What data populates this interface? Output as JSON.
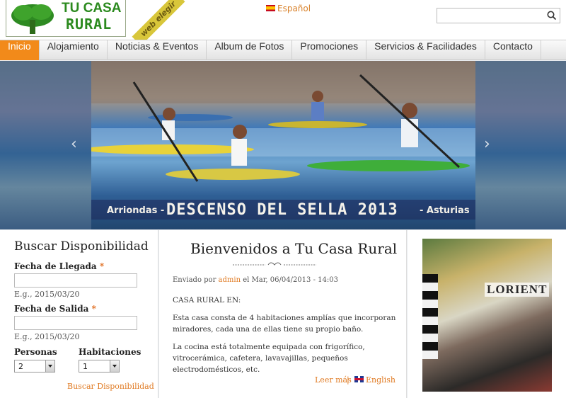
{
  "header": {
    "logo_line1": "TU CASA",
    "logo_line2": "RURAL",
    "ribbon": "web elegir",
    "language": "Español",
    "search_placeholder": "",
    "search_icon": "magnifier-icon"
  },
  "nav": {
    "items": [
      {
        "label": "Inicio"
      },
      {
        "label": "Alojamiento"
      },
      {
        "label": "Noticias & Eventos"
      },
      {
        "label": "Album de Fotos"
      },
      {
        "label": "Promociones"
      },
      {
        "label": "Servicios & Facilidades"
      },
      {
        "label": "Contacto"
      }
    ],
    "active_color": "#f28a1a"
  },
  "banner": {
    "caption_left": "Arriondas -",
    "caption_main": "DESCENSO DEL SELLA 2013",
    "caption_right": "- Asturias",
    "prev": "‹",
    "next": "›"
  },
  "search_box": {
    "title": "Buscar Disponibilidad",
    "arrival_label": "Fecha de Llegada",
    "arrival_hint": "E.g., 2015/03/20",
    "departure_label": "Fecha de Salida",
    "departure_hint": "E.g., 2015/03/20",
    "required_mark": "*",
    "persons_label": "Personas",
    "persons_value": "2",
    "rooms_label": "Habitaciones",
    "rooms_value": "1",
    "submit": "Buscar Disponibilidad"
  },
  "article": {
    "title": "Bienvenidos a Tu Casa Rural",
    "meta_prefix": "Enviado por",
    "author": "admin",
    "meta_date": "el Mar, 06/04/2013 - 14:03",
    "heading": "CASA RURAL EN:",
    "paragraph1": "Esta casa consta de 4 habitaciones amplías que incorporan miradores, cada una de ellas tiene su propio baño.",
    "paragraph2": "La cocina está totalmente equipada con frigorífico, vitrocerámica, cafetera, lavavajillas, pequeños electrodomésticos, etc.",
    "read_more": "Leer más",
    "separator": "|",
    "english": "English"
  },
  "promo": {
    "label": "LORIENT"
  }
}
